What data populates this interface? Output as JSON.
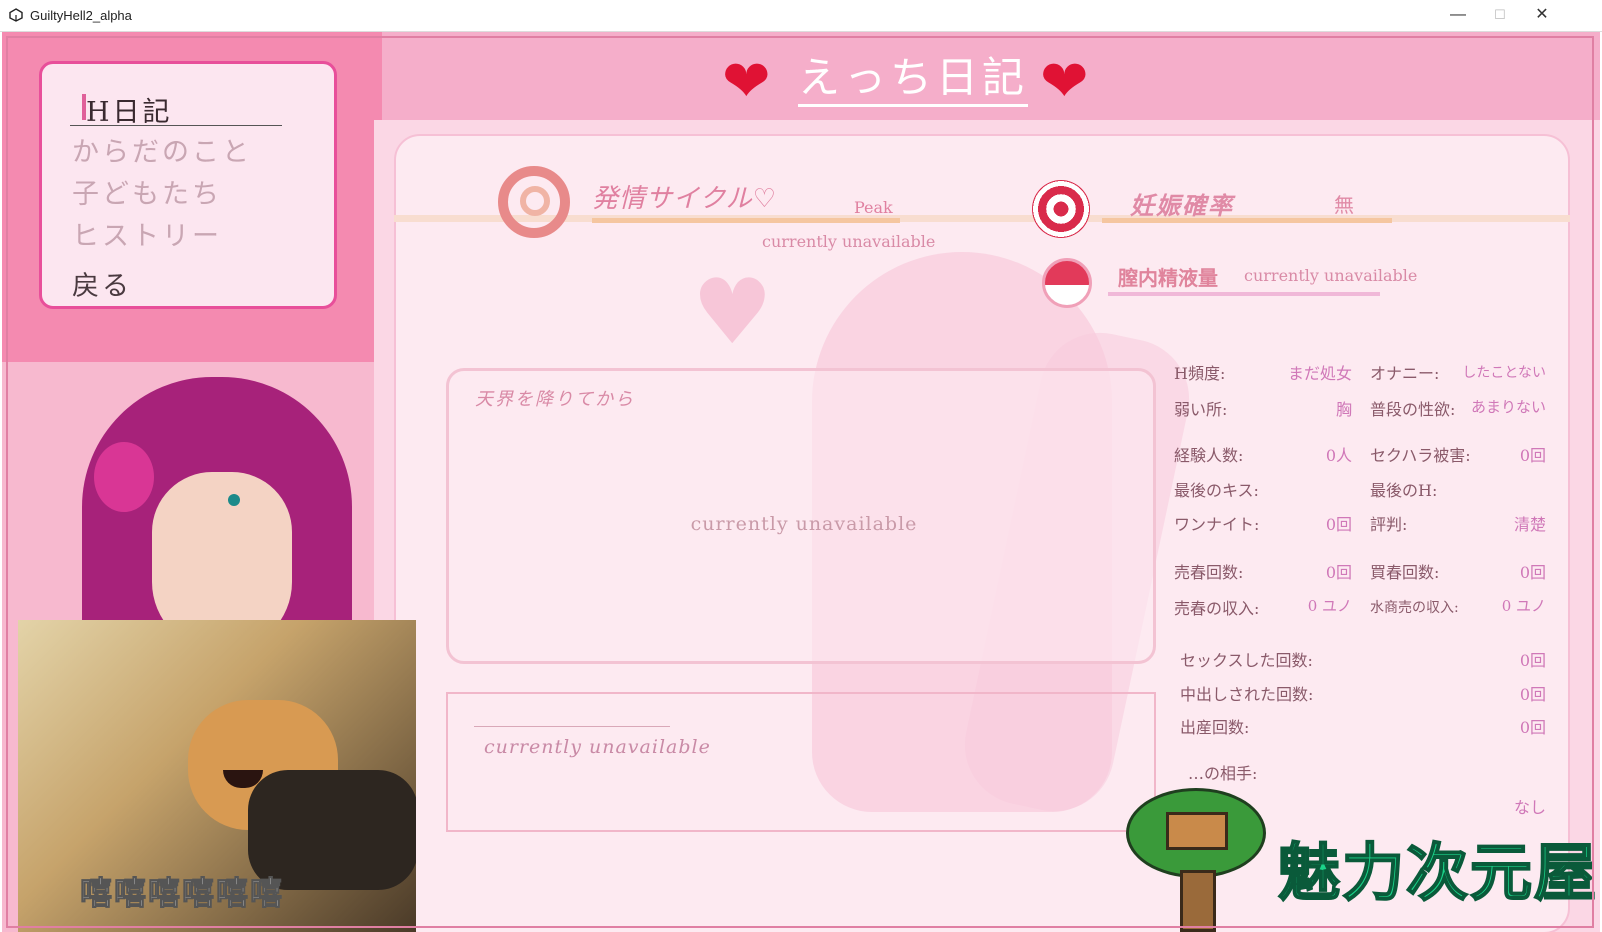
{
  "window": {
    "title": "GuiltyHell2_alpha",
    "controls": [
      "—",
      "☐",
      "✕"
    ]
  },
  "menu": {
    "items": [
      {
        "label": "H日記",
        "state": "active"
      },
      {
        "label": "からだのこと",
        "state": "disabled"
      },
      {
        "label": "子どもたち",
        "state": "disabled"
      },
      {
        "label": "ヒストリー",
        "state": "disabled"
      },
      {
        "label": "戻る",
        "state": "normal"
      }
    ]
  },
  "header": {
    "title": "えっち日記",
    "heart_glyph": "❤"
  },
  "cycle": {
    "label": "発情サイクル♡",
    "value": "Peak",
    "status": "currently unavailable"
  },
  "pregnancy": {
    "label": "妊娠確率",
    "value": "無"
  },
  "fluid": {
    "label": "膣内精液量",
    "status": "currently unavailable"
  },
  "story": {
    "title": "天界を降りてから",
    "status": "currently unavailable"
  },
  "note": {
    "status": "currently unavailable"
  },
  "stats": {
    "h_freq_label": "H頻度:",
    "h_freq_value": "まだ処女",
    "onanie_label": "オナニー:",
    "onanie_value": "したことない",
    "weak_label": "弱い所:",
    "weak_value": "胸",
    "libido_label": "普段の性欲:",
    "libido_value": "あまりない",
    "partners_label": "経験人数:",
    "partners_value": "0人",
    "harass_label": "セクハラ被害:",
    "harass_value": "0回",
    "last_kiss_label": "最後のキス:",
    "last_h_label": "最後のH:",
    "onenight_label": "ワンナイト:",
    "onenight_value": "0回",
    "reputation_label": "評判:",
    "reputation_value": "清楚",
    "sold_label": "売春回数:",
    "sold_value": "0回",
    "bought_label": "買春回数:",
    "bought_value": "0回",
    "sold_income_label": "売春の収入:",
    "sold_income_value": "0 ユノ",
    "water_income_label": "水商売の収入:",
    "water_income_value": "0 ユノ",
    "sex_count_label": "セックスした回数:",
    "sex_count_value": "0回",
    "creampie_label": "中出しされた回数:",
    "creampie_value": "0回",
    "birth_label": "出産回数:",
    "birth_value": "0回",
    "partner_label": "…の相手:",
    "partner_value": "なし"
  },
  "overlay": {
    "meme_caption": "嘻嘻嘻嘻嘻嘻",
    "watermark_text": "魅力次元屋"
  },
  "colors": {
    "accent_pink": "#f48ab0",
    "menu_border": "#e84f9a",
    "watermark_green": "#1bd48a"
  }
}
